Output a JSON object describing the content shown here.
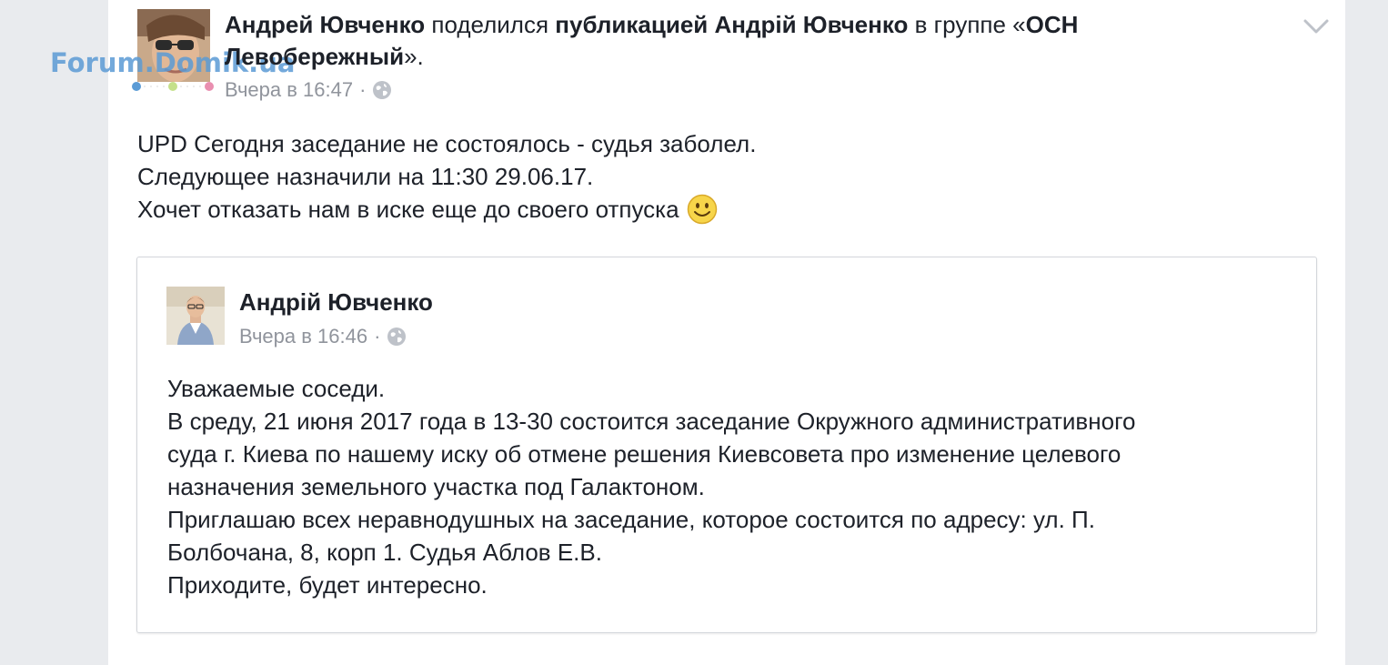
{
  "watermark": {
    "text": "Forum.Domik.ua"
  },
  "post": {
    "author": "Андрей Ювченко",
    "action_text": " поделился ",
    "object_text": "публикацией Андрій Ювченко",
    "group_prefix": " в группе «",
    "group_name_part1": "ОСН",
    "group_name_part2": "Левобережный",
    "group_suffix": "».",
    "timestamp": "Вчера в 16:47",
    "separator": "·",
    "privacy_icon": "globe-icon",
    "text_lines": [
      "UPD Сегодня заседание не состоялось - судья заболел.",
      "Следующее назначили на 11:30 29.06.17.",
      "Хочет отказать нам в иске еще до своего отпуска"
    ],
    "emoji": "smiley-emoji"
  },
  "shared_post": {
    "author": "Андрій Ювченко",
    "timestamp": "Вчера в 16:46",
    "separator": "·",
    "privacy_icon": "globe-icon",
    "text_lines": [
      "Уважаемые соседи.",
      "В среду, 21 июня 2017 года в 13-30 состоится заседание Окружного административного",
      "суда г. Киева по нашему иску об отмене решения Киевсовета про изменение целевого",
      "назначения земельного участка под Галактоном.",
      "Приглашаю всех неравнодушных на заседание, которое состоится по адресу: ул. П.",
      "Болбочана, 8, корп 1. Судья Аблов Е.В.",
      "Приходите, будет интересно."
    ]
  },
  "colors": {
    "background": "#e9ebee",
    "card": "#ffffff",
    "text": "#1d2129",
    "meta_text": "#90949c",
    "watermark": "#5b9bd5"
  }
}
